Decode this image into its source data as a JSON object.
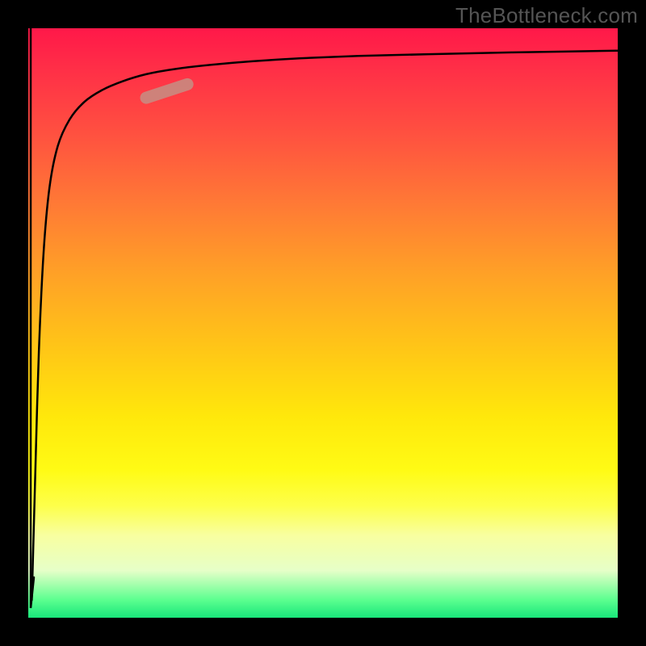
{
  "watermark": "TheBottleneck.com",
  "colors": {
    "marker": "#c98a80",
    "curve": "#000000",
    "background": "#000000"
  },
  "chart_data": {
    "type": "line",
    "title": "",
    "xlabel": "",
    "ylabel": "",
    "xlim": [
      0,
      100
    ],
    "ylim": [
      0,
      100
    ],
    "grid": false,
    "series": [
      {
        "name": "bottleneck-curve",
        "x_norm": [
          0.6,
          0.8,
          1.2,
          1.8,
          2.6,
          3.6,
          5.0,
          7.0,
          9.5,
          12.5,
          16.0,
          20.0,
          25.0,
          31.0,
          38.0,
          46.0,
          56.0,
          68.0,
          82.0,
          100.0
        ],
        "y_norm": [
          3.0,
          10.0,
          25.0,
          45.0,
          62.0,
          73.0,
          80.0,
          84.5,
          87.5,
          89.5,
          91.0,
          92.2,
          93.1,
          93.8,
          94.4,
          94.9,
          95.3,
          95.6,
          95.9,
          96.2
        ]
      }
    ],
    "marker": {
      "x_norm_range": [
        20.0,
        27.0
      ],
      "y_norm_range": [
        88.2,
        90.5
      ],
      "description": "highlighted segment on curve"
    },
    "annotations": []
  }
}
